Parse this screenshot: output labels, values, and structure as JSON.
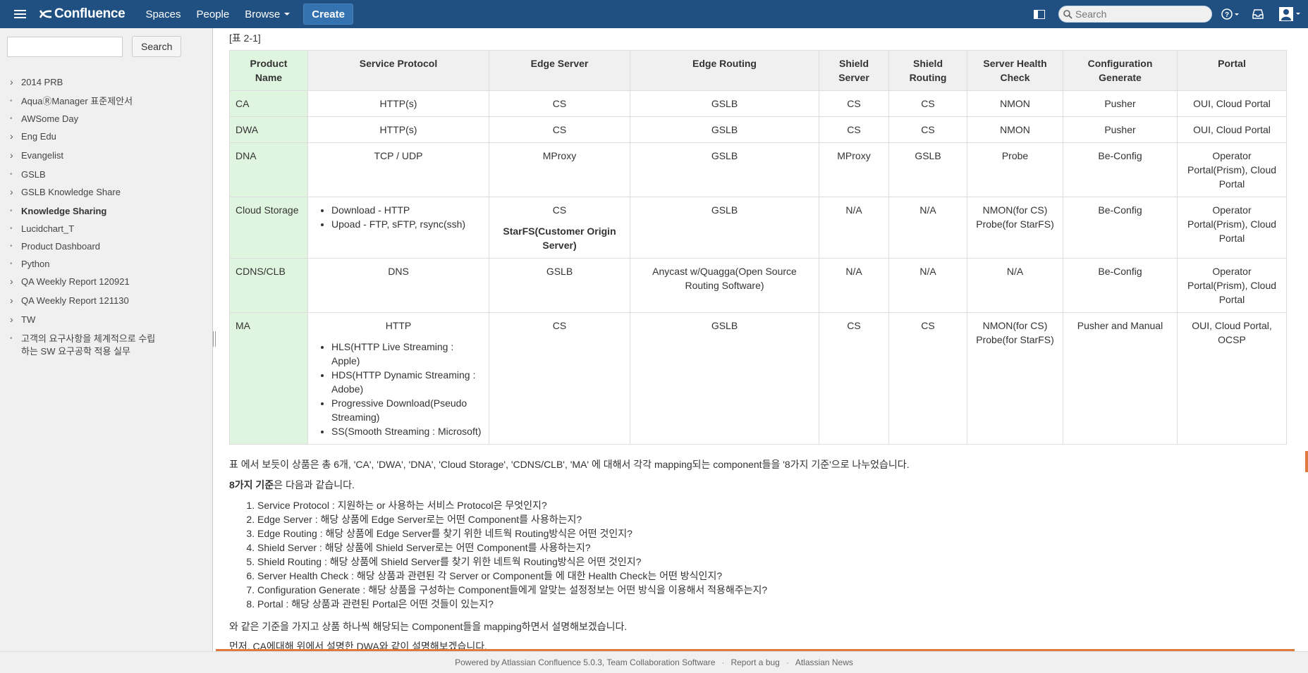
{
  "header": {
    "logo": "Confluence",
    "nav": [
      "Spaces",
      "People",
      "Browse"
    ],
    "create_label": "Create",
    "search_placeholder": "Search",
    "accent": "#205081"
  },
  "sidebar": {
    "search_value": "",
    "search_button": "Search",
    "items": [
      {
        "label": "2014 PRB",
        "expandable": true
      },
      {
        "label": "AquaⓇManager 표준제안서",
        "expandable": false
      },
      {
        "label": "AWSome Day",
        "expandable": false
      },
      {
        "label": "Eng Edu",
        "expandable": true
      },
      {
        "label": "Evangelist",
        "expandable": true
      },
      {
        "label": "GSLB",
        "expandable": false
      },
      {
        "label": "GSLB Knowledge Share",
        "expandable": true
      },
      {
        "label": "Knowledge Sharing",
        "expandable": false,
        "current": true
      },
      {
        "label": "Lucidchart_T",
        "expandable": false
      },
      {
        "label": "Product Dashboard",
        "expandable": false
      },
      {
        "label": "Python",
        "expandable": false
      },
      {
        "label": "QA Weekly Report 120921",
        "expandable": true
      },
      {
        "label": "QA Weekly Report 121130",
        "expandable": true
      },
      {
        "label": "TW",
        "expandable": true
      },
      {
        "label": "고객의 요구사항을 체계적으로 수립하는 SW 요구공학 적용 실무",
        "expandable": false
      }
    ]
  },
  "main": {
    "caption": "[표 2-1]",
    "table": {
      "headers": [
        "Product Name",
        "Service Protocol",
        "Edge Server",
        "Edge Routing",
        "Shield Server",
        "Shield Routing",
        "Server Health Check",
        "Configuration Generate",
        "Portal"
      ],
      "rows": {
        "ca": {
          "name": "CA",
          "protocol": "HTTP(s)",
          "edge_server": "CS",
          "edge_routing": "GSLB",
          "shield_server": "CS",
          "shield_routing": "CS",
          "health": "NMON",
          "config": "Pusher",
          "portal": "OUI, Cloud Portal"
        },
        "dwa": {
          "name": "DWA",
          "protocol": "HTTP(s)",
          "edge_server": "CS",
          "edge_routing": "GSLB",
          "shield_server": "CS",
          "shield_routing": "CS",
          "health": "NMON",
          "config": "Pusher",
          "portal": "OUI, Cloud Portal"
        },
        "dna": {
          "name": "DNA",
          "protocol": "TCP / UDP",
          "edge_server": "MProxy",
          "edge_routing": "GSLB",
          "shield_server": "MProxy",
          "shield_routing": "GSLB",
          "health": "Probe",
          "config": "Be-Config",
          "portal": "Operator Portal(Prism), Cloud Portal"
        },
        "cloud": {
          "name": "Cloud Storage",
          "protocol_items": [
            "Download - HTTP",
            "Upoad - FTP, sFTP, rsync(ssh)"
          ],
          "edge_server": "CS",
          "edge_server_extra": "StarFS(Customer Origin Server)",
          "edge_routing": "GSLB",
          "shield_server": "N/A",
          "shield_routing": "N/A",
          "health": "NMON(for CS) Probe(for StarFS)",
          "config": "Be-Config",
          "portal": "Operator Portal(Prism), Cloud Portal"
        },
        "cdns": {
          "name": "CDNS/CLB",
          "protocol": "DNS",
          "edge_server": "GSLB",
          "edge_routing": "Anycast w/Quagga(Open Source Routing Software)",
          "shield_server": "N/A",
          "shield_routing": "N/A",
          "health": "N/A",
          "config": "Be-Config",
          "portal": "Operator Portal(Prism), Cloud Portal"
        },
        "ma": {
          "name": "MA",
          "protocol": "HTTP",
          "protocol_items": [
            "HLS(HTTP Live Streaming : Apple)",
            "HDS(HTTP Dynamic Streaming : Adobe)",
            "Progressive Download(Pseudo Streaming)",
            "SS(Smooth Streaming : Microsoft)"
          ],
          "edge_server": "CS",
          "edge_routing": "GSLB",
          "shield_server": "CS",
          "shield_routing": "CS",
          "health": "NMON(for CS) Probe(for StarFS)",
          "config": "Pusher and Manual",
          "portal": "OUI, Cloud Portal, OCSP"
        }
      }
    },
    "para1": "표 에서 보듯이 상품은 총 6개, 'CA', 'DWA', 'DNA', 'Cloud Storage', 'CDNS/CLB', 'MA' 에 대해서 각각 mapping되는 component들을 '8가지 기준'으로 나누었습니다.",
    "para2_bold": "8가지 기준",
    "para2_rest": "은 다음과 같습니다.",
    "criteria": [
      "Service Protocol : 지원하는 or 사용하는 서비스 Protocol은 무엇인지?",
      "Edge Server : 해당 상품에 Edge Server로는 어떤 Component를 사용하는지?",
      "Edge Routing : 해당 상품에 Edge Server를 찾기 위한 네트웍 Routing방식은 어떤 것인지?",
      "Shield Server : 해당 상품에 Shield Server로는 어떤 Component를 사용하는지?",
      "Shield Routing : 해당 상품에 Shield Server를 찾기 위한 네트웍 Routing방식은 어떤 것인지?",
      "Server Health Check : 해당 상품과 관련된 각 Server or Component들 에 대한 Health Check는 어떤 방식인지?",
      "Configuration Generate : 해당 상품을 구성하는 Component들에게 알맞는 설정정보는 어떤 방식을 이용해서 적용해주는지?",
      "Portal : 해당 상품과 관련된 Portal은 어떤 것들이 있는지?"
    ],
    "para3": "와 같은 기준을 가지고 상품 하나씩 해당되는 Component들을 mapping하면서 설명해보겠습니다.",
    "para4_cut": "먼저, CA에대해 위에서 설명한 DWA와 같이 설명해보겠습니다."
  },
  "footer": {
    "powered": "Powered by Atlassian Confluence 5.0.3, Team Collaboration Software",
    "report": "Report a bug",
    "news": "Atlassian News"
  }
}
